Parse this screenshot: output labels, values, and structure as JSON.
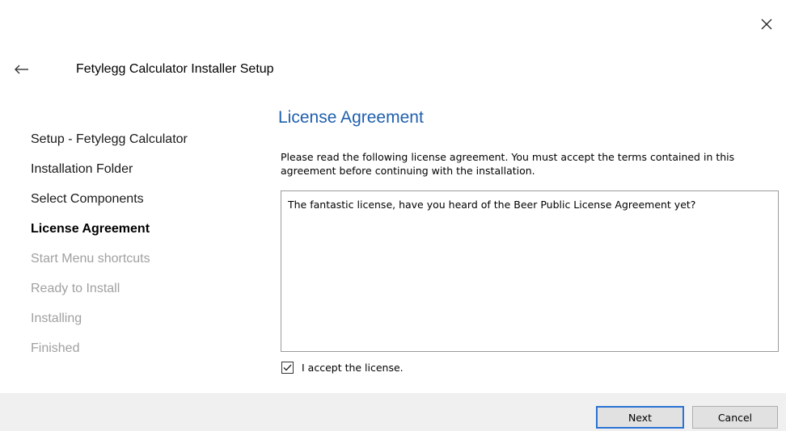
{
  "window": {
    "title": "Fetylegg Calculator Installer Setup"
  },
  "sidebar": {
    "steps": [
      {
        "label": "Setup - Fetylegg Calculator",
        "state": "done"
      },
      {
        "label": "Installation Folder",
        "state": "done"
      },
      {
        "label": "Select Components",
        "state": "done"
      },
      {
        "label": "License Agreement",
        "state": "current"
      },
      {
        "label": "Start Menu shortcuts",
        "state": "pending"
      },
      {
        "label": "Ready to Install",
        "state": "pending"
      },
      {
        "label": "Installing",
        "state": "pending"
      },
      {
        "label": "Finished",
        "state": "pending"
      }
    ]
  },
  "page": {
    "heading": "License Agreement",
    "description": "Please read the following license agreement. You must accept the terms contained in this agreement before continuing with the installation.",
    "license_text": "The fantastic license, have you heard of the Beer Public License Agreement yet?",
    "accept_label": "I accept the license.",
    "accept_checked": true
  },
  "footer": {
    "next_label": "Next",
    "cancel_label": "Cancel"
  },
  "colors": {
    "heading": "#1f5fae",
    "pending_step": "#a0a0a0",
    "footer_bg": "#f0f0f0",
    "default_button_border": "#2b73d4"
  },
  "icons": {
    "close": "close-icon",
    "back": "back-arrow-icon",
    "check": "checkmark-icon"
  }
}
